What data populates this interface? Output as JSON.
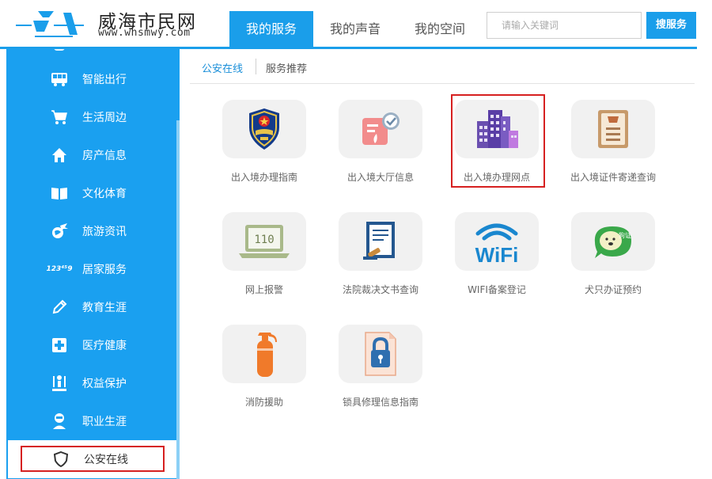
{
  "header": {
    "site_title": "威海市民网",
    "site_url": "www.whsmwy.com",
    "tabs": [
      {
        "label": "我的服务",
        "active": true
      },
      {
        "label": "我的声音",
        "active": false
      },
      {
        "label": "我的空间",
        "active": false
      }
    ],
    "search": {
      "placeholder": "请输入关键词",
      "button_label": "搜服务"
    }
  },
  "sidebar": {
    "items": [
      {
        "label": "智能出行",
        "icon": "bus-icon"
      },
      {
        "label": "生活周边",
        "icon": "cart-icon"
      },
      {
        "label": "房产信息",
        "icon": "home-icon"
      },
      {
        "label": "文化体育",
        "icon": "book-icon"
      },
      {
        "label": "旅游资讯",
        "icon": "travel-globe-icon"
      },
      {
        "label": "居家服务",
        "icon": "numbers-icon",
        "icon_text": "123⁴⁵9"
      },
      {
        "label": "教育生涯",
        "icon": "pencil-icon"
      },
      {
        "label": "医疗健康",
        "icon": "medical-cross-icon"
      },
      {
        "label": "权益保护",
        "icon": "rights-icon"
      },
      {
        "label": "职业生涯",
        "icon": "worker-icon"
      },
      {
        "label": "公安在线",
        "icon": "shield-icon",
        "active": true
      }
    ]
  },
  "main": {
    "subtabs": [
      {
        "label": "公安在线",
        "active": true
      },
      {
        "label": "服务推荐",
        "active": false
      }
    ],
    "services": [
      {
        "label": "出入境办理指南",
        "icon": "police-emblem-icon"
      },
      {
        "label": "出入境大厅信息",
        "icon": "hall-info-icon"
      },
      {
        "label": "出入境办理网点",
        "icon": "buildings-icon",
        "highlighted": true
      },
      {
        "label": "出入境证件寄递查询",
        "icon": "certificate-icon"
      },
      {
        "label": "网上报警",
        "icon": "laptop-110-icon",
        "icon_text": "110"
      },
      {
        "label": "法院裁决文书查询",
        "icon": "court-document-icon"
      },
      {
        "label": "WIFI备案登记",
        "icon": "wifi-icon",
        "icon_text": "WiFi"
      },
      {
        "label": "犬只办证预约",
        "icon": "dog-license-icon",
        "icon_text": "狗证"
      },
      {
        "label": "消防援助",
        "icon": "fire-extinguisher-icon"
      },
      {
        "label": "锁具修理信息指南",
        "icon": "lock-document-icon"
      }
    ]
  },
  "colors": {
    "primary": "#1a9eea",
    "sidebar": "#1aa0f0",
    "highlight": "#d62020",
    "tile": "#f1f1f1"
  }
}
